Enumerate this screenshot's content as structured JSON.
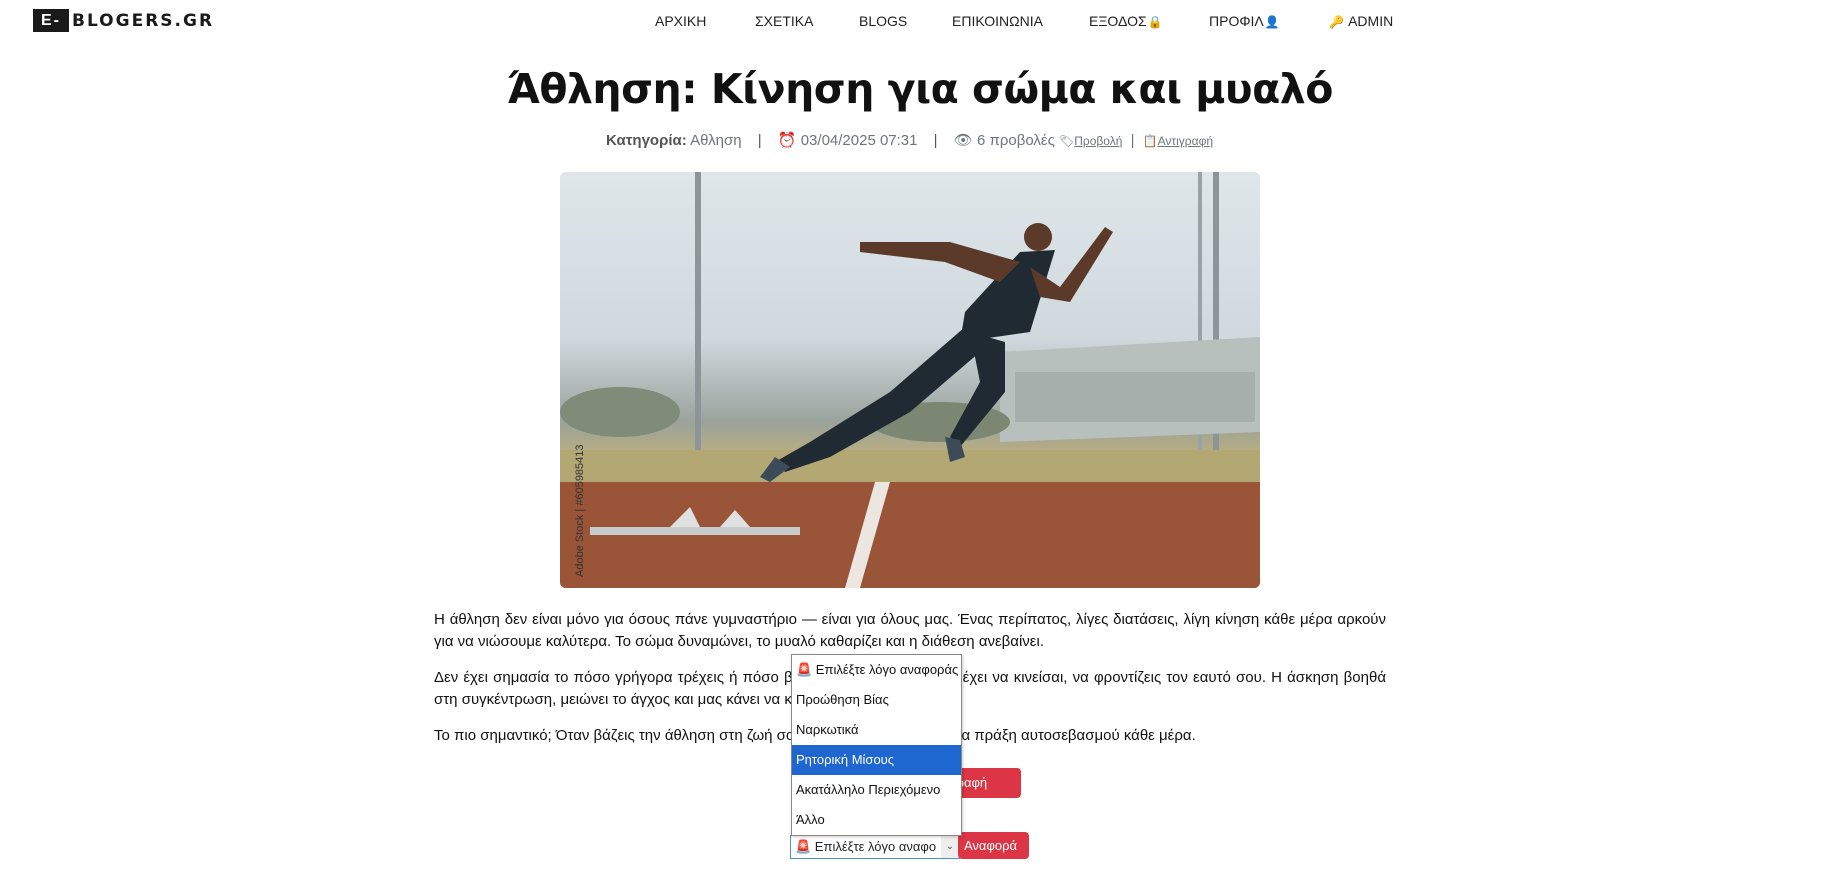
{
  "header": {
    "logo_prefix": "E-",
    "logo_text": "BLOGERS.GR",
    "nav": {
      "home": "ΑΡΧΙΚΗ",
      "about": "ΣΧΕΤΙΚΑ",
      "blogs": "BLOGS",
      "contact": "ΕΠΙΚΟΙΝΩΝΙΑ",
      "logout": "ΕΞΟΔΟΣ",
      "profile": "ΠΡΟΦΙΛ",
      "admin": "ADMIN"
    },
    "icons": {
      "logout": "lock-icon",
      "profile": "user-icon",
      "admin": "key-icon"
    }
  },
  "post": {
    "title": "Άθληση: Κίνηση για σώμα και μυαλό",
    "category_label": "Κατηγορία:",
    "category": "Αθληση",
    "date": "03/04/2025 07:31",
    "views": "6 προβολές",
    "view_link": "Προβολή",
    "copy_link": "Αντιγραφή",
    "image_watermark": "Adobe Stock | #605985413",
    "paragraphs": [
      "Η άθληση δεν είναι μόνο για όσους πάνε γυμναστήριο — είναι για όλους μας. Ένας περίπατος, λίγες διατάσεις, λίγη κίνηση κάθε μέρα αρκούν για να νιώσουμε καλύτερα. Το σώμα δυναμώνει, το μυαλό καθαρίζει και η διάθεση ανεβαίνει.",
      "Δεν έχει σημασία το πόσο γρήγορα τρέχεις ή πόσο βάρος σηκώνεις. Σημασία έχει να κινείσαι, να φροντίζεις τον εαυτό σου. Η άσκηση βοηθά στη συγκέντρωση, μειώνει το άγχος και μας κάνει να κοιμόμαστε καλύτερα.",
      "Το πιο σημαντικό; Όταν βάζεις την άθληση στη ζωή σου, χτίζεις μια συνήθεια, μια πράξη αυτοσεβασμού κάθε μέρα."
    ],
    "delete_button": "Διαγραφή"
  },
  "report": {
    "dropdown_options": [
      "🚨 Επιλέξτε λόγο αναφοράς",
      "Προώθηση Βίας",
      "Ναρκωτικά",
      "Ρητορική Μίσους",
      "Ακατάλληλο Περιεχόμενο",
      "Άλλο"
    ],
    "highlighted_option": "Ρητορική Μίσους",
    "select_value": "🚨 Επιλέξτε λόγο αναφο",
    "report_button": "Αναφορά"
  },
  "colors": {
    "accent_red": "#dc3545",
    "highlight_blue": "#1e66d0"
  }
}
